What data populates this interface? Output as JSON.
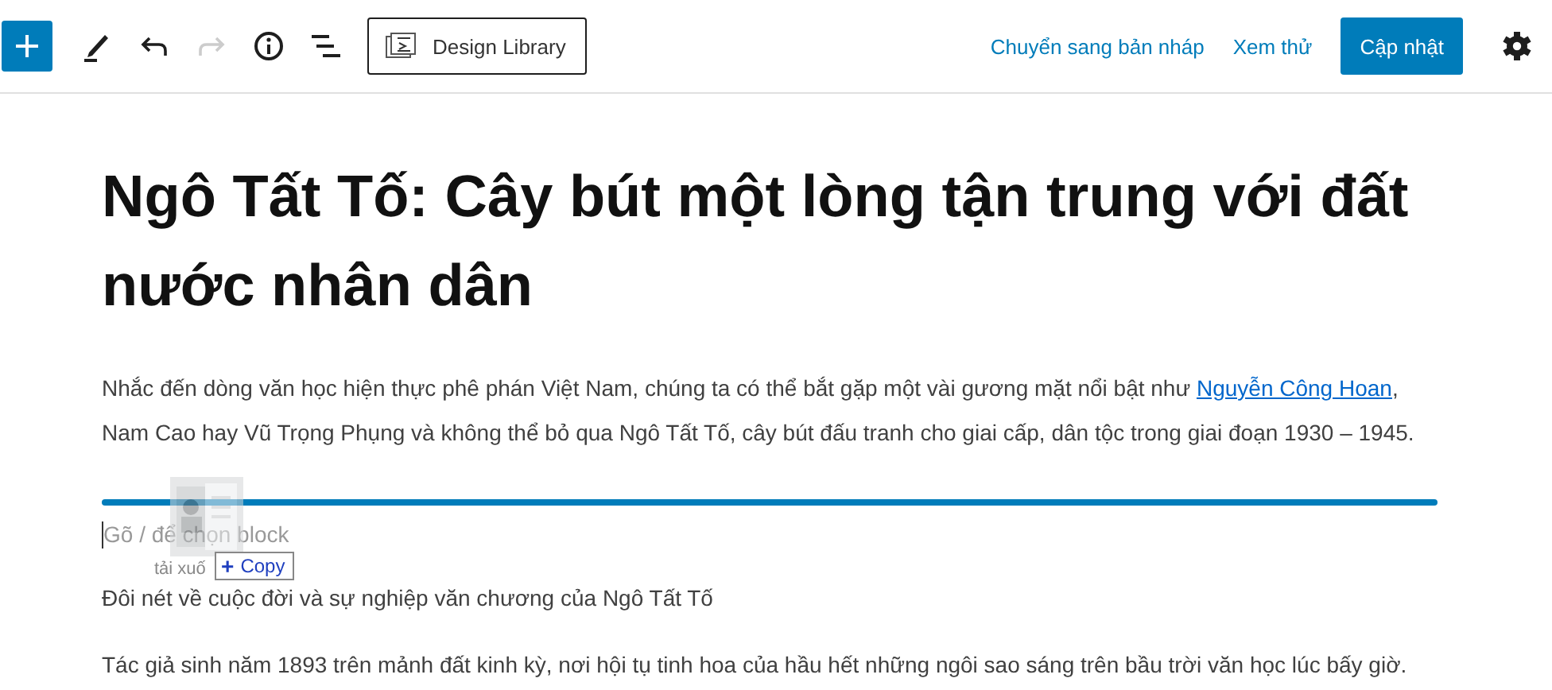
{
  "toolbar": {
    "tools": [
      {
        "kind": "add",
        "disabled": false
      },
      {
        "kind": "pen",
        "disabled": false
      },
      {
        "kind": "undo",
        "disabled": false
      },
      {
        "kind": "redo",
        "disabled": true
      },
      {
        "kind": "info",
        "disabled": false
      },
      {
        "kind": "outline",
        "disabled": false
      }
    ],
    "library_button": "Design Library",
    "draft_link": "Chuyển sang bản nháp",
    "preview_link": "Xem thử",
    "update_button": "Cập nhật"
  },
  "post": {
    "title": "Ngô Tất Tố: Cây bút một lòng tận trung với đất nước nhân dân",
    "intro": {
      "before": "Nhắc đến dòng văn học hiện thực phê phán Việt Nam, chúng ta có thể bắt gặp một vài gương mặt nổi bật như ",
      "link": "Nguyễn Công Hoan",
      "after": ", Nam Cao hay Vũ Trọng Phụng và không thể bỏ qua Ngô Tất Tố, cây bút đấu tranh cho giai cấp, dân tộc trong giai đoạn 1930 – 1945."
    },
    "new_block": {
      "placeholder": "Gõ / để chọn block"
    },
    "paragraphs": [
      "Đôi nét về cuộc đời và sự nghiệp văn chương của Ngô Tất Tố",
      "Tác giả sinh năm 1893 trên mảnh đất kinh kỳ, nơi hội tụ tinh hoa của hầu hết những ngôi sao sáng trên bầu trời văn học lúc bấy giờ."
    ]
  },
  "drag": {
    "label": "tải xuố",
    "badge": "Copy",
    "badge_icon": "+"
  }
}
